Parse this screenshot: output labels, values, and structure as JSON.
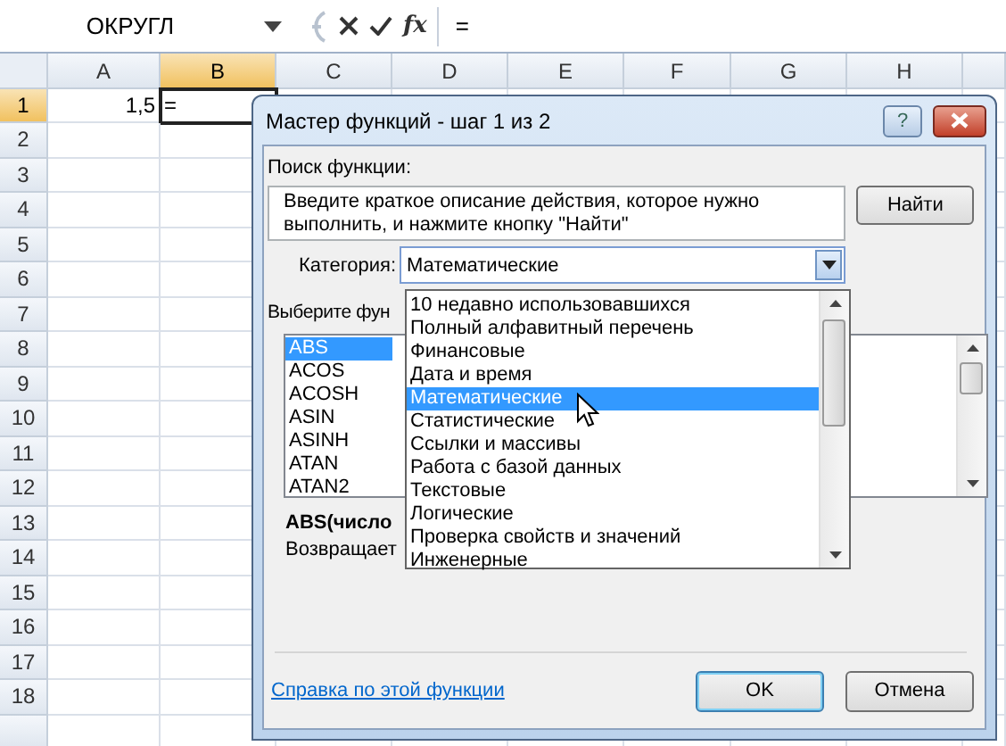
{
  "formula_bar": {
    "name_box": "ОКРУГЛ",
    "insert_function": "fx",
    "formula": "="
  },
  "sheet": {
    "columns": [
      {
        "label": "A",
        "selected": false
      },
      {
        "label": "B",
        "selected": true
      },
      {
        "label": "C",
        "selected": false
      },
      {
        "label": "D",
        "selected": false
      },
      {
        "label": "E",
        "selected": false
      },
      {
        "label": "F",
        "selected": false
      },
      {
        "label": "G",
        "selected": false
      },
      {
        "label": "H",
        "selected": false
      }
    ],
    "rows": [
      {
        "label": "1",
        "selected": true,
        "cells": [
          {
            "text": "1,5",
            "selected": false
          },
          {
            "text": "=",
            "selected": true
          }
        ]
      },
      {
        "label": "2",
        "selected": false,
        "cells": []
      },
      {
        "label": "3",
        "selected": false,
        "cells": []
      },
      {
        "label": "4",
        "selected": false,
        "cells": []
      },
      {
        "label": "5",
        "selected": false,
        "cells": []
      },
      {
        "label": "6",
        "selected": false,
        "cells": []
      },
      {
        "label": "7",
        "selected": false,
        "cells": []
      },
      {
        "label": "8",
        "selected": false,
        "cells": []
      },
      {
        "label": "9",
        "selected": false,
        "cells": []
      },
      {
        "label": "10",
        "selected": false,
        "cells": []
      },
      {
        "label": "11",
        "selected": false,
        "cells": []
      },
      {
        "label": "12",
        "selected": false,
        "cells": []
      },
      {
        "label": "13",
        "selected": false,
        "cells": []
      },
      {
        "label": "14",
        "selected": false,
        "cells": []
      },
      {
        "label": "15",
        "selected": false,
        "cells": []
      },
      {
        "label": "16",
        "selected": false,
        "cells": []
      },
      {
        "label": "17",
        "selected": false,
        "cells": []
      },
      {
        "label": "18",
        "selected": false,
        "cells": []
      }
    ]
  },
  "dialog": {
    "title": "Мастер функций - шаг 1 из 2",
    "help_button": "?",
    "search_label": "Поиск функции:",
    "search_field": {
      "value": "Введите краткое описание действия, которое нужно выполнить, и нажмите кнопку \"Найти\""
    },
    "find_button": "Найти",
    "category_label": "Категория:",
    "category_value": "Математические",
    "category_options": [
      {
        "label": "10 недавно использовавшихся",
        "selected": false
      },
      {
        "label": "Полный алфавитный перечень",
        "selected": false
      },
      {
        "label": "Финансовые",
        "selected": false
      },
      {
        "label": "Дата и время",
        "selected": false
      },
      {
        "label": "Математические",
        "selected": true
      },
      {
        "label": "Статистические",
        "selected": false
      },
      {
        "label": "Ссылки и массивы",
        "selected": false
      },
      {
        "label": "Работа с базой данных",
        "selected": false
      },
      {
        "label": "Текстовые",
        "selected": false
      },
      {
        "label": "Логические",
        "selected": false
      },
      {
        "label": "Проверка свойств и значений",
        "selected": false
      },
      {
        "label": "Инженерные",
        "selected": false
      }
    ],
    "function_label": "Выберите фун",
    "functions": [
      {
        "label": "ABS",
        "selected": true
      },
      {
        "label": "ACOS",
        "selected": false
      },
      {
        "label": "ACOSH",
        "selected": false
      },
      {
        "label": "ASIN",
        "selected": false
      },
      {
        "label": "ASINH",
        "selected": false
      },
      {
        "label": "ATAN",
        "selected": false
      },
      {
        "label": "ATAN2",
        "selected": false
      }
    ],
    "signature": "ABS(число",
    "description": "Возвращает",
    "help_link": "Справка по этой функции",
    "buttons": [
      "OK",
      "Отмена"
    ]
  }
}
